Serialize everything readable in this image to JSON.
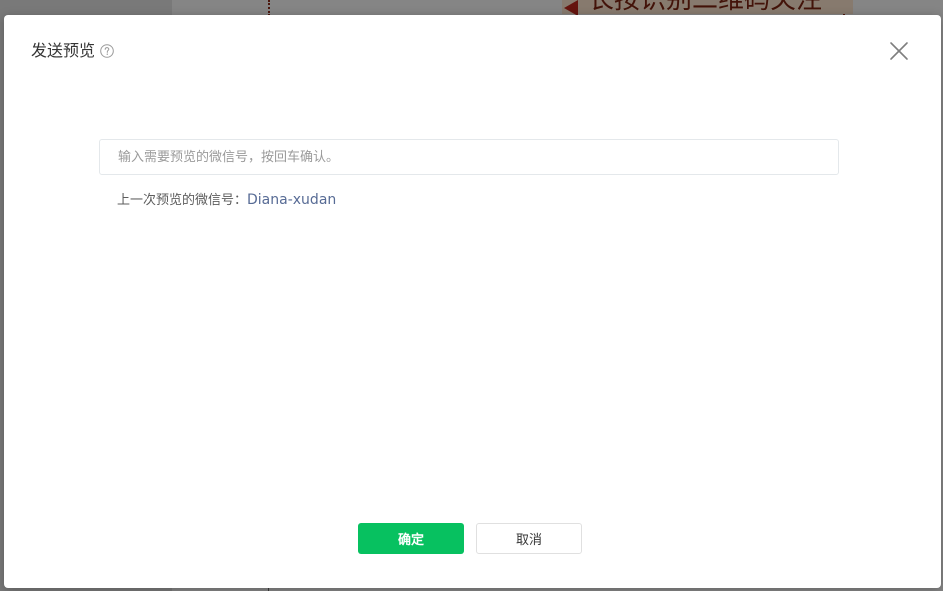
{
  "background": {
    "banner_text": "长按识别二维码关注"
  },
  "modal": {
    "title": "发送预览",
    "help_icon": "question-circle-icon",
    "close_icon": "close-x-icon",
    "input": {
      "value": "",
      "placeholder": "输入需要预览的微信号，按回车确认。"
    },
    "last_preview": {
      "label": "上一次预览的微信号：",
      "value": "Diana-xudan"
    },
    "confirm_label": "确定",
    "cancel_label": "取消"
  },
  "colors": {
    "primary": "#07c160",
    "link": "#576b95",
    "title_text": "#353535"
  }
}
